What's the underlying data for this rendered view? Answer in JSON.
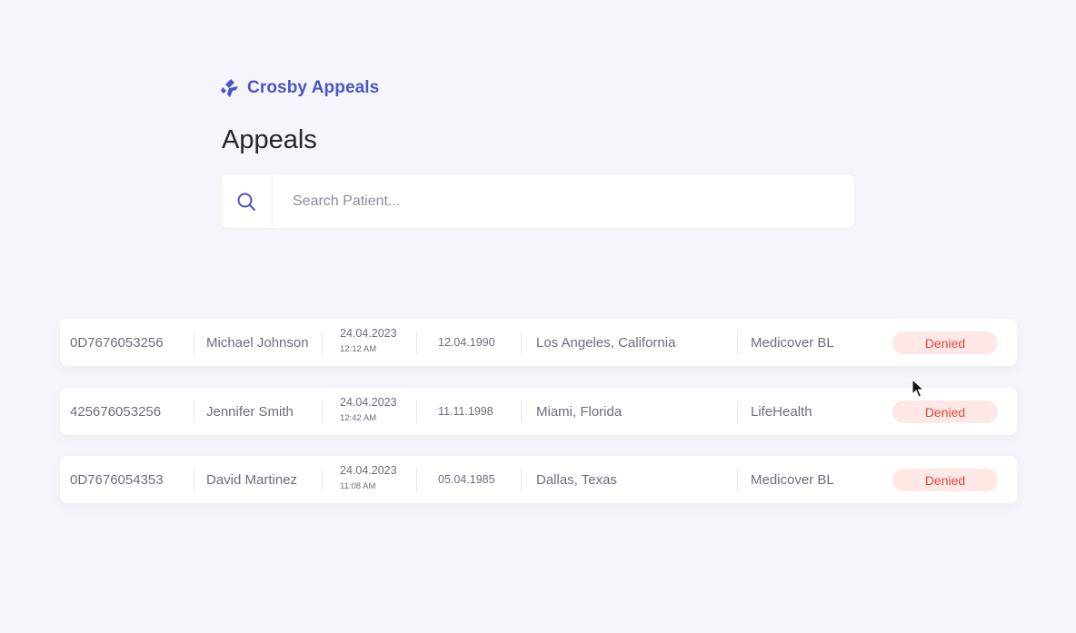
{
  "brand": {
    "name": "Crosby Appeals",
    "color": "#4a55c6"
  },
  "page": {
    "title": "Appeals"
  },
  "search": {
    "placeholder": "Search Patient...",
    "value": ""
  },
  "appeals": [
    {
      "id": "0D7676053256",
      "name": "Michael Johnson",
      "date": "24.04.2023",
      "time": "12:12 AM",
      "dob": "12.04.1990",
      "location": "Los Angeles, California",
      "insurer": "Medicover BL",
      "status": "Denied"
    },
    {
      "id": "425676053256",
      "name": "Jennifer Smith",
      "date": "24.04.2023",
      "time": "12:42 AM",
      "dob": "11.11.1998",
      "location": "Miami, Florida",
      "insurer": "LifeHealth",
      "status": "Denied"
    },
    {
      "id": "0D7676054353",
      "name": "David Martinez",
      "date": "24.04.2023",
      "time": "11:08 AM",
      "dob": "05.04.1985",
      "location": "Dallas, Texas",
      "insurer": "Medicover BL",
      "status": "Denied"
    }
  ],
  "colors": {
    "background": "#f5f6fb",
    "accent": "#4a55c6",
    "denied_bg": "#fde8e6",
    "denied_text": "#e0483a"
  }
}
